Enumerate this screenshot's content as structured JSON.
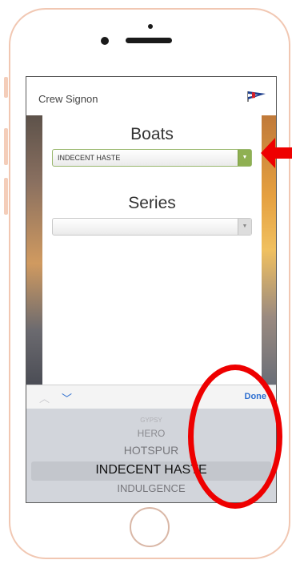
{
  "app": {
    "title": "Crew Signon"
  },
  "boats": {
    "label": "Boats",
    "selected": "INDECENT HASTE"
  },
  "series": {
    "label": "Series",
    "selected": ""
  },
  "accessory": {
    "done_label": "Done"
  },
  "picker": {
    "items": [
      "GYPSY",
      "HERO",
      "HOTSPUR",
      "INDECENT HASTE",
      "INDULGENCE"
    ],
    "selected_index": 3
  },
  "colors": {
    "accent_green": "#8fb052",
    "ios_blue": "#2e6fd0",
    "annotation_red": "#ee0000"
  },
  "icons": {
    "flag": "burgee-flag-icon",
    "select_arrow": "chevron-down-icon",
    "prev": "chevron-up-icon",
    "next": "chevron-down-icon",
    "annotation_arrow": "red-arrow-icon"
  }
}
